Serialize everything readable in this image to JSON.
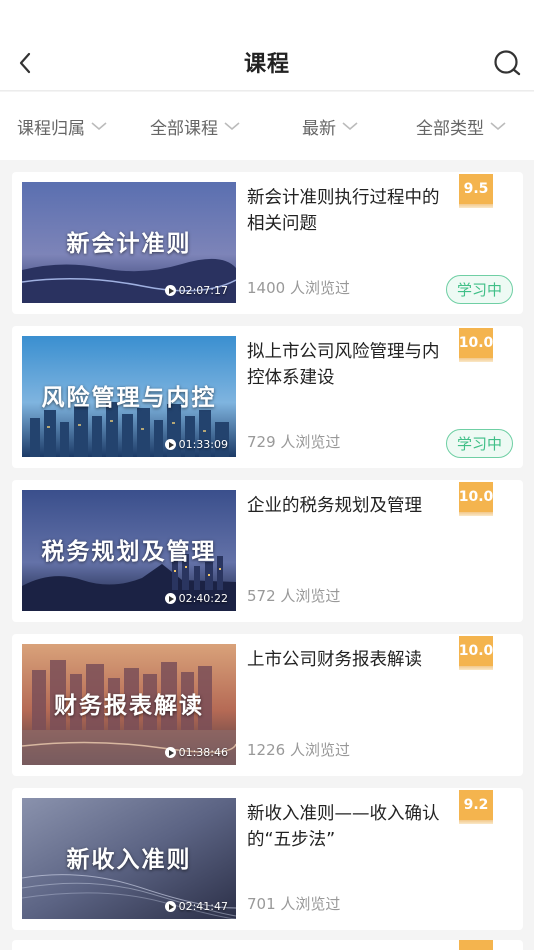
{
  "header": {
    "title": "课程"
  },
  "filters": [
    {
      "label": "课程归属"
    },
    {
      "label": "全部课程"
    },
    {
      "label": "最新"
    },
    {
      "label": "全部类型"
    }
  ],
  "courses": [
    {
      "thumb_title": "新会计准则",
      "duration": "02:07:17",
      "title": "新会计准则执行过程中的相关问题",
      "views": "1400 人浏览过",
      "score": "9.5",
      "status": "学习中"
    },
    {
      "thumb_title": "风险管理与内控",
      "duration": "01:33:09",
      "title": "拟上市公司风险管理与内控体系建设",
      "views": "729 人浏览过",
      "score": "10.0",
      "status": "学习中"
    },
    {
      "thumb_title": "税务规划及管理",
      "duration": "02:40:22",
      "title": "企业的税务规划及管理",
      "views": "572 人浏览过",
      "score": "10.0",
      "status": ""
    },
    {
      "thumb_title": "财务报表解读",
      "duration": "01:38:46",
      "title": "上市公司财务报表解读",
      "views": "1226 人浏览过",
      "score": "10.0",
      "status": ""
    },
    {
      "thumb_title": "新收入准则",
      "duration": "02:41:47",
      "title": "新收入准则——收入确认的“五步法”",
      "views": "701 人浏览过",
      "score": "9.2",
      "status": ""
    }
  ],
  "colors": {
    "accent_score": "#f4b44e",
    "status_green": "#3fbf87"
  }
}
